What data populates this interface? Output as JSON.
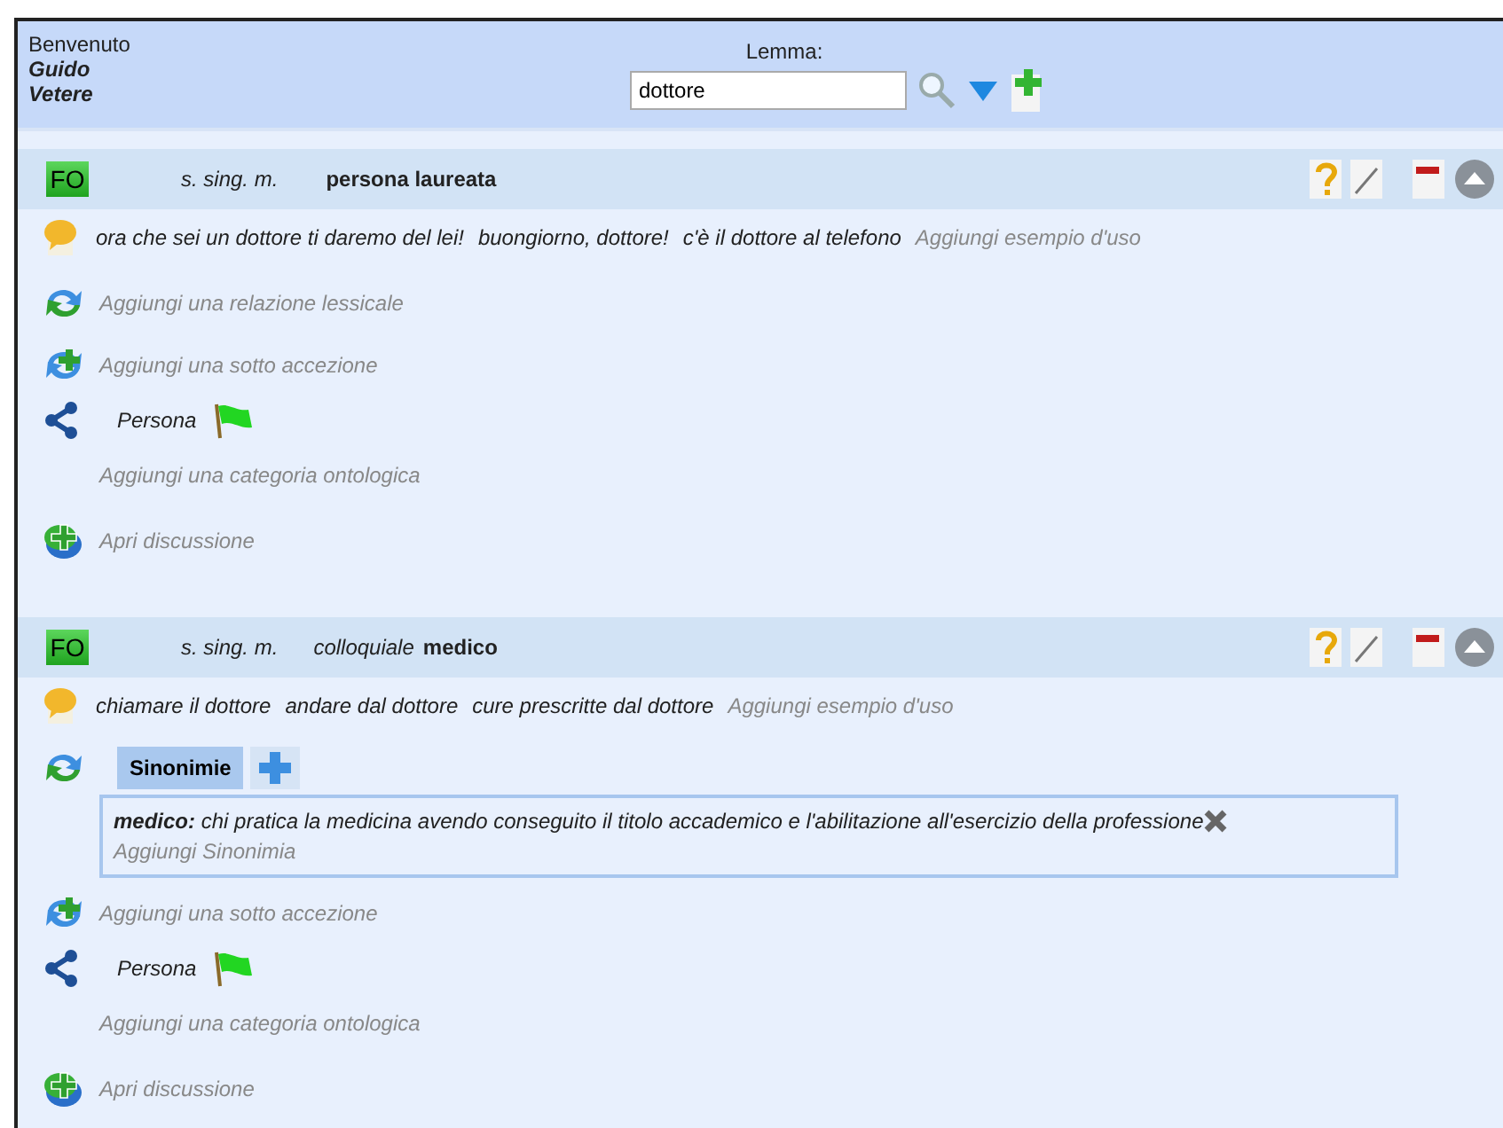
{
  "header": {
    "welcome": "Benvenuto",
    "user_first": "Guido",
    "user_last": "Vetere",
    "lemma_label": "Lemma:",
    "lemma_value": "dottore"
  },
  "senses": [
    {
      "badge": "FO",
      "grammar": "s. sing. m.",
      "definition": "persona laureata",
      "examples": [
        "ora che sei un dottore ti daremo del lei!",
        "buongiorno, dottore!",
        "c'è il dottore al telefono"
      ],
      "add_example": "Aggiungi esempio d'uso",
      "add_relation": "Aggiungi una relazione lessicale",
      "add_subsense": "Aggiungi una sotto accezione",
      "categories": [
        "Persona"
      ],
      "add_category": "Aggiungi una categoria ontologica",
      "discussion": "Apri discussione"
    },
    {
      "badge": "FO",
      "grammar": "s. sing. m.",
      "register": "colloquiale",
      "definition": "medico",
      "examples": [
        "chiamare il dottore",
        "andare dal dottore",
        "cure prescritte dal dottore"
      ],
      "add_example": "Aggiungi esempio d'uso",
      "relations": {
        "tabs": [
          {
            "label": "Sinonimie",
            "selected": true
          }
        ],
        "entries": [
          "**medico:** chi pratica la medicina avendo conseguito il titolo accademico e l'abilitazione all'esercizio della professione"
        ],
        "add": "Aggiungi Sinonimia"
      },
      "add_subsense": "Aggiungi una sotto accezione",
      "categories": [
        "Persona"
      ],
      "add_category": "Aggiungi una categoria ontologica",
      "discussion": "Apri discussione"
    }
  ]
}
